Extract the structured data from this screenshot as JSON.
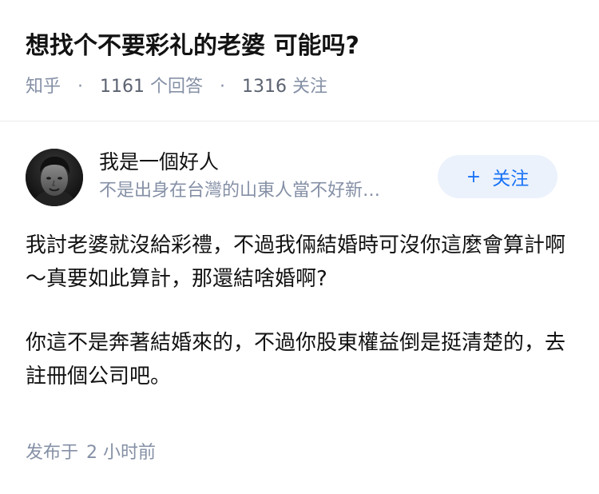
{
  "question": {
    "title": "想找个不要彩礼的老婆 可能吗?",
    "source": "知乎",
    "separator": "·",
    "answers_count": "1161",
    "answers_label": "个回答",
    "followers_count": "1316",
    "followers_label": "关注"
  },
  "author": {
    "name": "我是一個好人",
    "bio": "不是出身在台灣的山東人當不好新…",
    "avatar_icon": "portrait-avatar",
    "follow": {
      "plus": "+",
      "label": "关注"
    }
  },
  "answer": {
    "paragraphs": [
      "我討老婆就沒給彩禮，不過我倆結婚時可沒你這麼會算計啊～真要如此算計，那還結啥婚啊?",
      "你這不是奔著結婚來的，不過你股東權益倒是挺清楚的，去註冊個公司吧。"
    ],
    "published_label": "发布于",
    "published_time": "2 小时前"
  },
  "colors": {
    "text": "#121212",
    "meta": "#8590a6",
    "accent": "#1772f6",
    "accent_bg": "#ebf2fc",
    "divider": "#ebebeb"
  }
}
